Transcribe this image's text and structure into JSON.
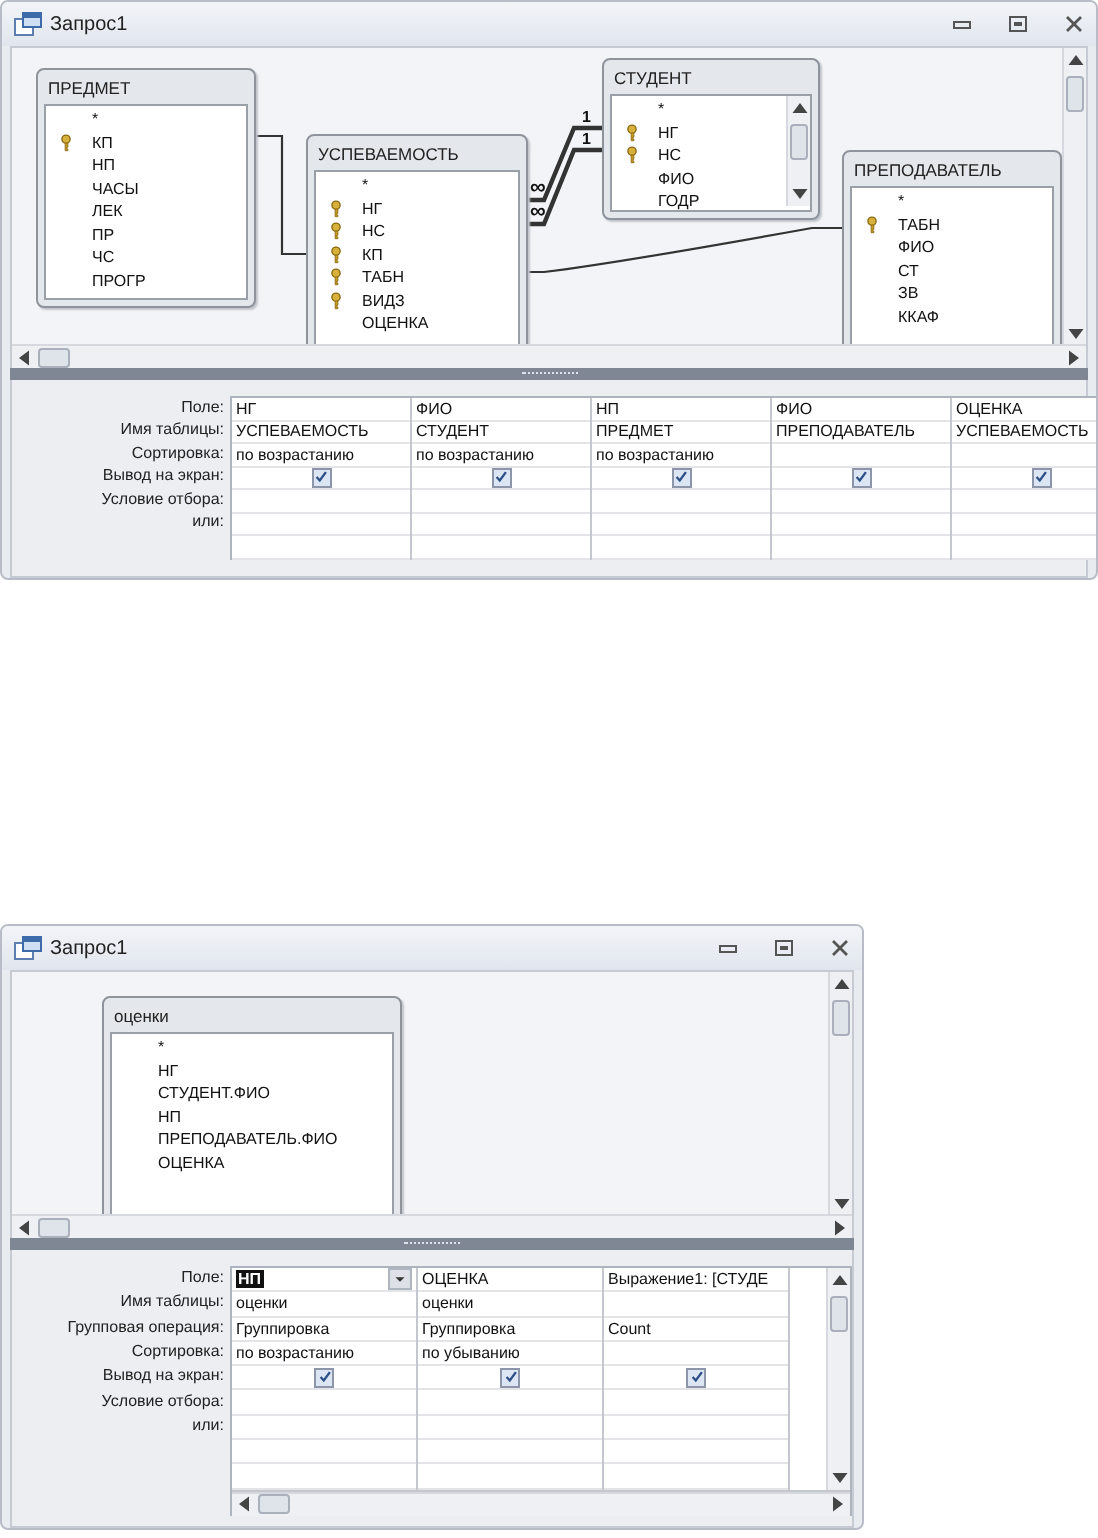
{
  "windows": [
    {
      "title": "Запрос1",
      "tables": [
        {
          "name": "ПРЕДМЕТ",
          "fields": [
            {
              "name": "*",
              "key": false
            },
            {
              "name": "КП",
              "key": true
            },
            {
              "name": "НП",
              "key": false
            },
            {
              "name": "ЧАСЫ",
              "key": false
            },
            {
              "name": "ЛЕК",
              "key": false
            },
            {
              "name": "ПР",
              "key": false
            },
            {
              "name": "ЧС",
              "key": false
            },
            {
              "name": "ПРОГР",
              "key": false
            }
          ]
        },
        {
          "name": "УСПЕВАЕМОСТЬ",
          "fields": [
            {
              "name": "*",
              "key": false
            },
            {
              "name": "НГ",
              "key": true
            },
            {
              "name": "НС",
              "key": true
            },
            {
              "name": "КП",
              "key": true
            },
            {
              "name": "ТАБН",
              "key": true
            },
            {
              "name": "ВИДЗ",
              "key": true
            },
            {
              "name": "ОЦЕНКА",
              "key": false
            }
          ]
        },
        {
          "name": "СТУДЕНТ",
          "fields": [
            {
              "name": "*",
              "key": false
            },
            {
              "name": "НГ",
              "key": true
            },
            {
              "name": "НС",
              "key": true
            },
            {
              "name": "ФИО",
              "key": false
            },
            {
              "name": "ГОДР",
              "key": false
            }
          ]
        },
        {
          "name": "ПРЕПОДАВАТЕЛЬ",
          "fields": [
            {
              "name": "*",
              "key": false
            },
            {
              "name": "ТАБН",
              "key": true
            },
            {
              "name": "ФИО",
              "key": false
            },
            {
              "name": "СТ",
              "key": false
            },
            {
              "name": "ЗВ",
              "key": false
            },
            {
              "name": "ККАФ",
              "key": false
            }
          ]
        }
      ],
      "relations": [
        {
          "kind": "plain"
        },
        {
          "kind": "one_to_many",
          "one": "1",
          "many": "∞"
        },
        {
          "kind": "one_to_many",
          "one": "1",
          "many": "∞"
        },
        {
          "kind": "plain"
        }
      ],
      "grid_rows": [
        {
          "label": "Поле:",
          "kind": "field"
        },
        {
          "label": "Имя таблицы:",
          "kind": "table"
        },
        {
          "label": "Сортировка:",
          "kind": "sort"
        },
        {
          "label": "Вывод на экран:",
          "kind": "show"
        },
        {
          "label": "Условие отбора:",
          "kind": "criteria"
        },
        {
          "label": "или:",
          "kind": "or"
        }
      ],
      "columns": [
        {
          "field": "НГ",
          "table": "УСПЕВАЕМОСТЬ",
          "sort": "по возрастанию",
          "show": true,
          "selected": false
        },
        {
          "field": "ФИО",
          "table": "СТУДЕНТ",
          "sort": "по возрастанию",
          "show": true,
          "selected": false
        },
        {
          "field": "НП",
          "table": "ПРЕДМЕТ",
          "sort": "по возрастанию",
          "show": true,
          "selected": false
        },
        {
          "field": "ФИО",
          "table": "ПРЕПОДАВАТЕЛЬ",
          "show": true,
          "selected": false
        },
        {
          "field": "ОЦЕНКА",
          "table": "УСПЕВАЕМОСТЬ",
          "show": true,
          "selected": false
        }
      ]
    },
    {
      "title": "Запрос1",
      "tables": [
        {
          "name": "оценки",
          "fields": [
            {
              "name": "*",
              "key": false
            },
            {
              "name": "НГ",
              "key": false
            },
            {
              "name": "СТУДЕНТ.ФИО",
              "key": false
            },
            {
              "name": "НП",
              "key": false
            },
            {
              "name": "ПРЕПОДАВАТЕЛЬ.ФИО",
              "key": false
            },
            {
              "name": "ОЦЕНКА",
              "key": false
            }
          ]
        }
      ],
      "grid_rows": [
        {
          "label": "Поле:",
          "kind": "field"
        },
        {
          "label": "Имя таблицы:",
          "kind": "table"
        },
        {
          "label": "Групповая операция:",
          "kind": "total"
        },
        {
          "label": "Сортировка:",
          "kind": "sort"
        },
        {
          "label": "Вывод на экран:",
          "kind": "show"
        },
        {
          "label": "Условие отбора:",
          "kind": "criteria"
        },
        {
          "label": "или:",
          "kind": "or"
        }
      ],
      "columns": [
        {
          "field": "НП",
          "table": "оценки",
          "total": "Группировка",
          "sort": "по возрастанию",
          "show": true,
          "selected": true
        },
        {
          "field": "ОЦЕНКА",
          "table": "оценки",
          "total": "Группировка",
          "sort": "по убыванию",
          "show": true,
          "selected": false
        },
        {
          "field": "Выражение1: [СТУДЕ",
          "total": "Count",
          "show": true,
          "selected": false
        }
      ]
    }
  ]
}
